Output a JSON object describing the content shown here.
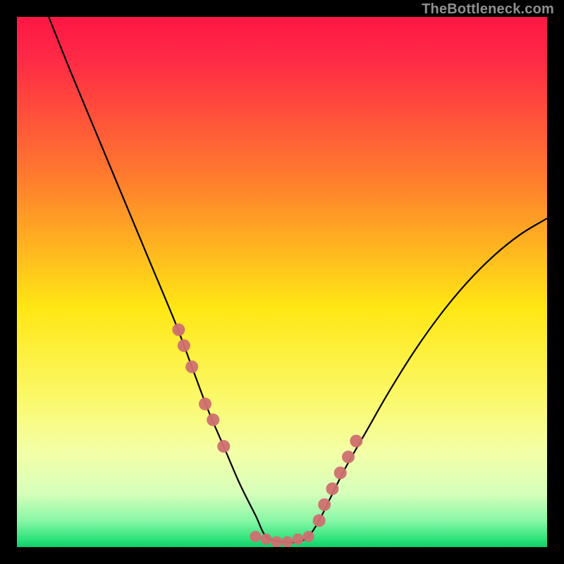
{
  "watermark": "TheBottleneck.com",
  "chart_data": {
    "type": "line",
    "title": "",
    "xlabel": "",
    "ylabel": "",
    "xlim": [
      0,
      100
    ],
    "ylim": [
      0,
      100
    ],
    "curve_description": "V-shaped bottleneck curve with minimum plateau near x≈47–55",
    "x": [
      6,
      10,
      15,
      20,
      25,
      30,
      33,
      36,
      39,
      42,
      45,
      47,
      50,
      53,
      55,
      57,
      59,
      62,
      66,
      70,
      75,
      80,
      85,
      90,
      95,
      100
    ],
    "values": [
      100,
      90,
      78,
      66,
      54,
      42,
      34,
      26,
      19,
      12,
      6,
      2,
      1,
      1,
      2,
      5,
      9,
      15,
      22,
      29,
      37,
      44,
      50,
      55,
      59,
      62
    ],
    "markers_left": {
      "x": [
        30.5,
        31.5,
        33.0,
        35.5,
        37.0,
        39.0
      ],
      "y": [
        41,
        38,
        34,
        27,
        24,
        19
      ]
    },
    "markers_right": {
      "x": [
        57.0,
        58.0,
        59.5,
        61.0,
        62.5,
        64.0
      ],
      "y": [
        5,
        8,
        11,
        14,
        17,
        20
      ]
    },
    "plateau_markers": {
      "x": [
        45,
        47,
        49,
        51,
        53,
        55
      ],
      "y": [
        2,
        1.5,
        1,
        1,
        1.5,
        2
      ]
    },
    "marker_color": "#cf7070",
    "curve_color": "#000000",
    "background_gradient": {
      "stops": [
        {
          "offset": 0.0,
          "color": "#ff1744"
        },
        {
          "offset": 0.08,
          "color": "#ff2a46"
        },
        {
          "offset": 0.3,
          "color": "#ff7a2e"
        },
        {
          "offset": 0.55,
          "color": "#ffe714"
        },
        {
          "offset": 0.72,
          "color": "#fbf96a"
        },
        {
          "offset": 0.82,
          "color": "#f4ffa7"
        },
        {
          "offset": 0.9,
          "color": "#d6ffbb"
        },
        {
          "offset": 0.95,
          "color": "#88f7a6"
        },
        {
          "offset": 0.985,
          "color": "#2ee37a"
        },
        {
          "offset": 1.0,
          "color": "#0ece6d"
        }
      ]
    }
  }
}
